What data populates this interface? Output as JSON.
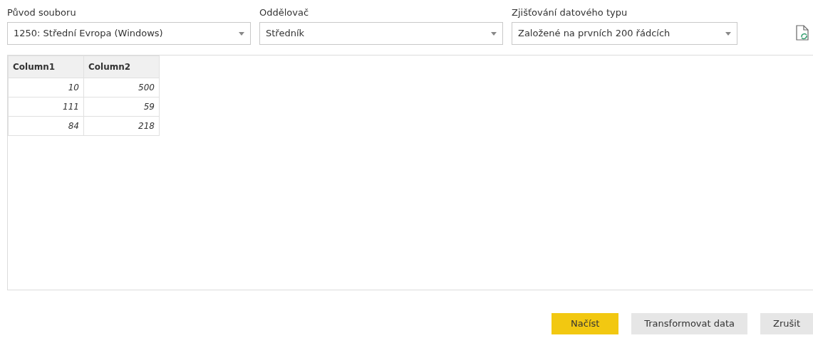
{
  "settings": [
    {
      "label": "Původ souboru",
      "value": "1250: Střední Evropa (Windows)"
    },
    {
      "label": "Oddělovač",
      "value": "Středník"
    },
    {
      "label": "Zjišťování datového typu",
      "value": "Založené na prvních 200 řádcích"
    }
  ],
  "table": {
    "columns": [
      "Column1",
      "Column2"
    ],
    "rows": [
      [
        "10",
        "500"
      ],
      [
        "111",
        "59"
      ],
      [
        "84",
        "218"
      ]
    ]
  },
  "buttons": [
    {
      "label": "Načíst",
      "kind": "primary"
    },
    {
      "label": "Transformovat data",
      "kind": "secondary"
    },
    {
      "label": "Zrušit",
      "kind": "secondary"
    }
  ]
}
